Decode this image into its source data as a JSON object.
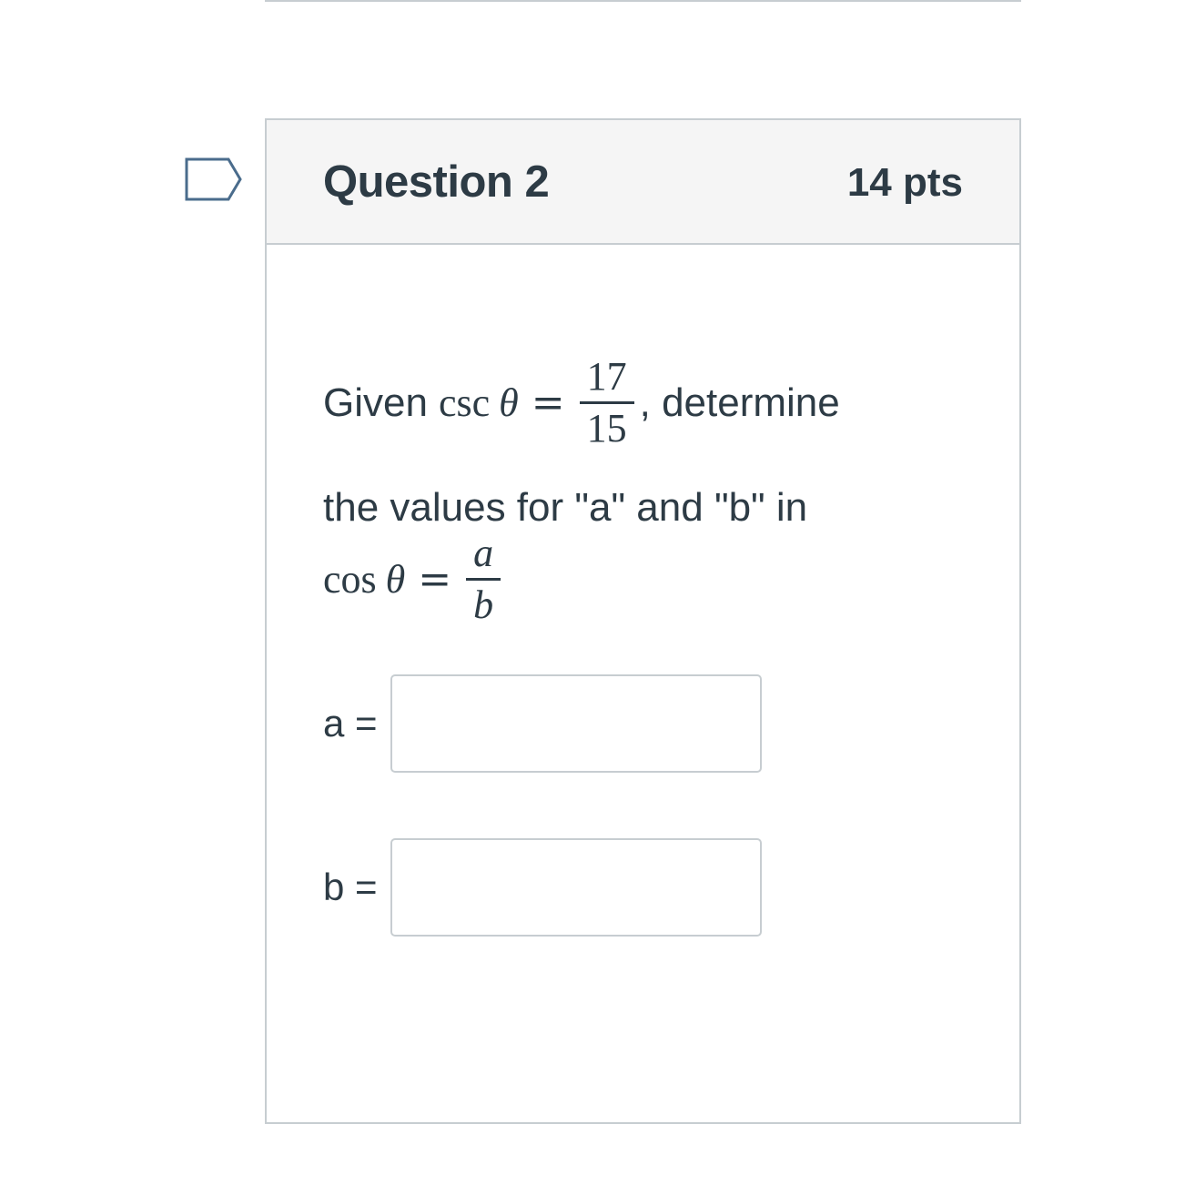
{
  "question": {
    "title": "Question 2",
    "points": "14 pts",
    "flag_icon": "flag-bookmark-icon"
  },
  "prompt": {
    "given": "Given",
    "csc": "csc",
    "theta": "θ",
    "equals": "=",
    "csc_numerator": "17",
    "csc_denominator": "15",
    "comma_determine": ", determine",
    "line2": "the values for \"a\" and \"b\" in",
    "cos": "cos",
    "cos_numerator": "a",
    "cos_denominator": "b"
  },
  "answers": [
    {
      "label": "a =",
      "value": "",
      "placeholder": ""
    },
    {
      "label": "b =",
      "value": "",
      "placeholder": ""
    }
  ],
  "colors": {
    "text": "#2d3b45",
    "border": "#c7cdd1",
    "header_bg": "#f5f5f5",
    "flag": "#4a6c8c"
  }
}
